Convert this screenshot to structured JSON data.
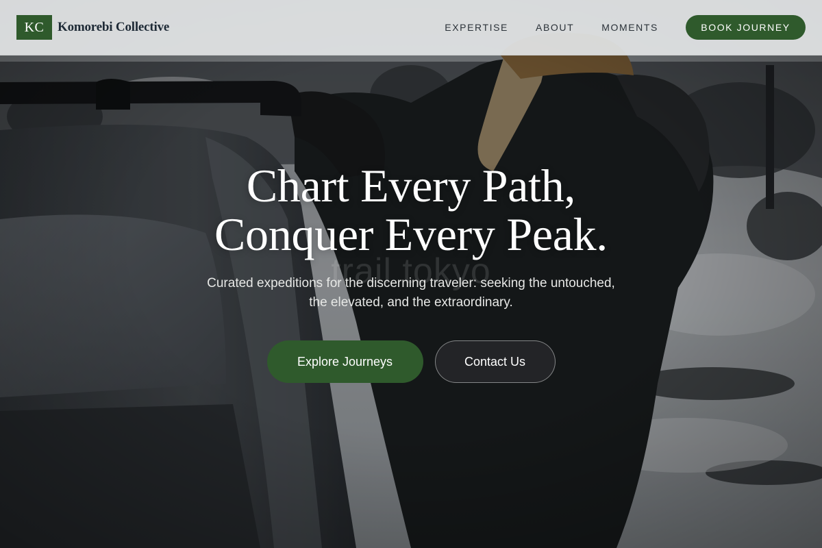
{
  "brand": {
    "mark": "KC",
    "name": "Komorebi Collective"
  },
  "nav": {
    "items": [
      {
        "label": "EXPERTISE"
      },
      {
        "label": "ABOUT"
      },
      {
        "label": "MOMENTS"
      }
    ],
    "cta_label": "BOOK JOURNEY"
  },
  "hero": {
    "title_line1": "Chart Every Path,",
    "title_line2": "Conquer Every Peak.",
    "subtitle_line1": "Curated expeditions for the discerning traveler: seeking the untouched,",
    "subtitle_line2": "the elevated, and the extraordinary.",
    "primary_button": "Explore Journeys",
    "secondary_button": "Contact Us",
    "photo_watermark": "trail tokyo"
  },
  "colors": {
    "brand_green": "#2f5a2c",
    "header_bg": "#e2e4e5",
    "heading_text": "#ffffff"
  }
}
